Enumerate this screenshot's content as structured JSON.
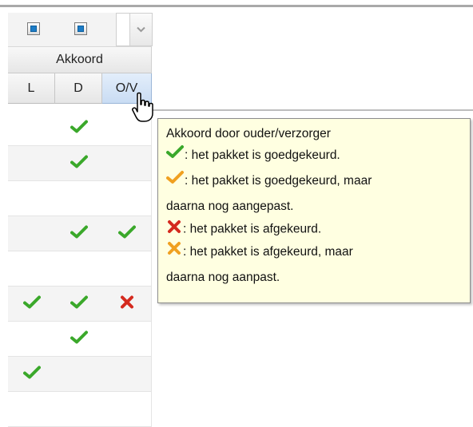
{
  "colors": {
    "check_green": "#3aa82a",
    "check_orange": "#f0a020",
    "cross_red": "#d42a1e",
    "cross_orange": "#f0a020",
    "tooltip_bg": "#ffffe1",
    "checkbox_blue": "#1c7cc6"
  },
  "toolbar": {
    "checkbox1_icon": "checkbox-indeterminate-icon",
    "checkbox2_icon": "checkbox-indeterminate-icon",
    "dropdown_icon": "chevron-down-icon",
    "dropdown_value": ""
  },
  "header": {
    "group_label": "Akkoord",
    "columns": [
      "L",
      "D",
      "O/V"
    ]
  },
  "rows": [
    {
      "L": "",
      "D": "check-green",
      "OV": ""
    },
    {
      "L": "",
      "D": "check-green",
      "OV": ""
    },
    {
      "L": "",
      "D": "",
      "OV": ""
    },
    {
      "L": "",
      "D": "check-green",
      "OV": "check-green"
    },
    {
      "L": "",
      "D": "",
      "OV": ""
    },
    {
      "L": "check-green",
      "D": "check-green",
      "OV": "cross-red"
    },
    {
      "L": "",
      "D": "check-green",
      "OV": ""
    },
    {
      "L": "check-green",
      "D": "",
      "OV": ""
    },
    {
      "L": "",
      "D": "",
      "OV": ""
    }
  ],
  "tooltip": {
    "title": "Akkoord door ouder/verzorger",
    "line1": ": het pakket is goedgekeurd.",
    "line2a": ": het pakket is goedgekeurd, maar",
    "line2b": "daarna nog aangepast.",
    "line3": ": het pakket is afgekeurd.",
    "line4a": ": het pakket is afgekeurd, maar",
    "line4b": "daarna nog aanpast."
  },
  "cursor": "hand-pointer-icon"
}
